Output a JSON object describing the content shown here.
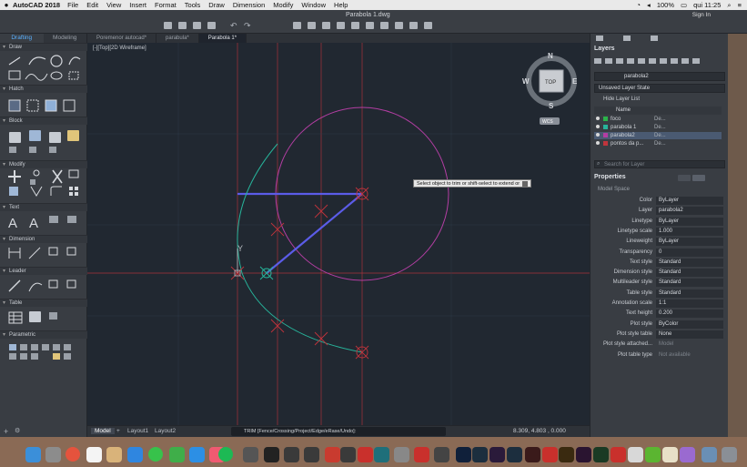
{
  "menubar": {
    "app_name": "AutoCAD 2018",
    "items": [
      "File",
      "Edit",
      "View",
      "Insert",
      "Format",
      "Tools",
      "Draw",
      "Dimension",
      "Modify",
      "Window",
      "Help"
    ],
    "battery": "100%",
    "clock": "qui 11:25"
  },
  "titlebar": {
    "title": "Parabola 1.dwg",
    "sign_in": "Sign In"
  },
  "left_panel": {
    "tabs": [
      "Drafting",
      "Modeling"
    ],
    "sections": [
      "Draw",
      "Hatch",
      "Block",
      "Modify",
      "Text",
      "Dimension",
      "Leader",
      "Table",
      "Parametric"
    ]
  },
  "doc_tabs": [
    "Poremenor autocad*",
    "parabula*",
    "Parabola 1*"
  ],
  "canvas": {
    "view_label": "[-][Top][2D Wireframe]",
    "viewcube": {
      "top": "TOP",
      "n": "N",
      "s": "S",
      "e": "E",
      "w": "W",
      "wcs": "WCS"
    },
    "tooltip": "Select object to trim or shift-select to extend or",
    "ucs_y": "Y",
    "colors": {
      "background": "#212831",
      "grid": "#c0343c",
      "circle": "#b33ea3",
      "lines": "#5b5ce8",
      "curve": "#27b39a",
      "marks": "#c0343c"
    }
  },
  "bottom_bar": {
    "tabs": [
      "Model",
      "Layout1",
      "Layout2"
    ],
    "command": "TRIM [Fence/Crossing/Project/Edge/eRase/Undo]:",
    "coords": "8.309, 4.803 , 0.000"
  },
  "layers": {
    "title": "Layers",
    "current_layer": "parabola2",
    "layer_state": "Unsaved Layer State",
    "hide_label": "Hide Layer List",
    "column_name": "Name",
    "rows": [
      {
        "name": "foco",
        "ltype": "De...",
        "color": "#2bb34a",
        "selected": false
      },
      {
        "name": "parabola 1",
        "ltype": "De...",
        "color": "#27b39a",
        "selected": false
      },
      {
        "name": "parabola2",
        "ltype": "De...",
        "color": "#b33ea3",
        "selected": true
      },
      {
        "name": "pontos da p...",
        "ltype": "De...",
        "color": "#c0343c",
        "selected": false
      }
    ],
    "search_placeholder": "Search for Layer"
  },
  "properties": {
    "title": "Properties",
    "section": "Model Space",
    "rows": [
      {
        "label": "Color",
        "value": "ByLayer"
      },
      {
        "label": "Layer",
        "value": "parabola2"
      },
      {
        "label": "Linetype",
        "value": "ByLayer"
      },
      {
        "label": "Linetype scale",
        "value": "1.000"
      },
      {
        "label": "Lineweight",
        "value": "ByLayer"
      },
      {
        "label": "Transparency",
        "value": "0"
      },
      {
        "label": "Text style",
        "value": "Standard"
      },
      {
        "label": "Dimension style",
        "value": "Standard"
      },
      {
        "label": "Multileader style",
        "value": "Standard"
      },
      {
        "label": "Table style",
        "value": "Standard"
      },
      {
        "label": "Annotation scale",
        "value": "1:1"
      },
      {
        "label": "Text height",
        "value": "0.200"
      },
      {
        "label": "Plot style",
        "value": "ByColor"
      },
      {
        "label": "Plot style table",
        "value": "None"
      },
      {
        "label": "Plot style attached...",
        "value": "Model"
      },
      {
        "label": "Plot table type",
        "value": "Not available"
      }
    ]
  }
}
